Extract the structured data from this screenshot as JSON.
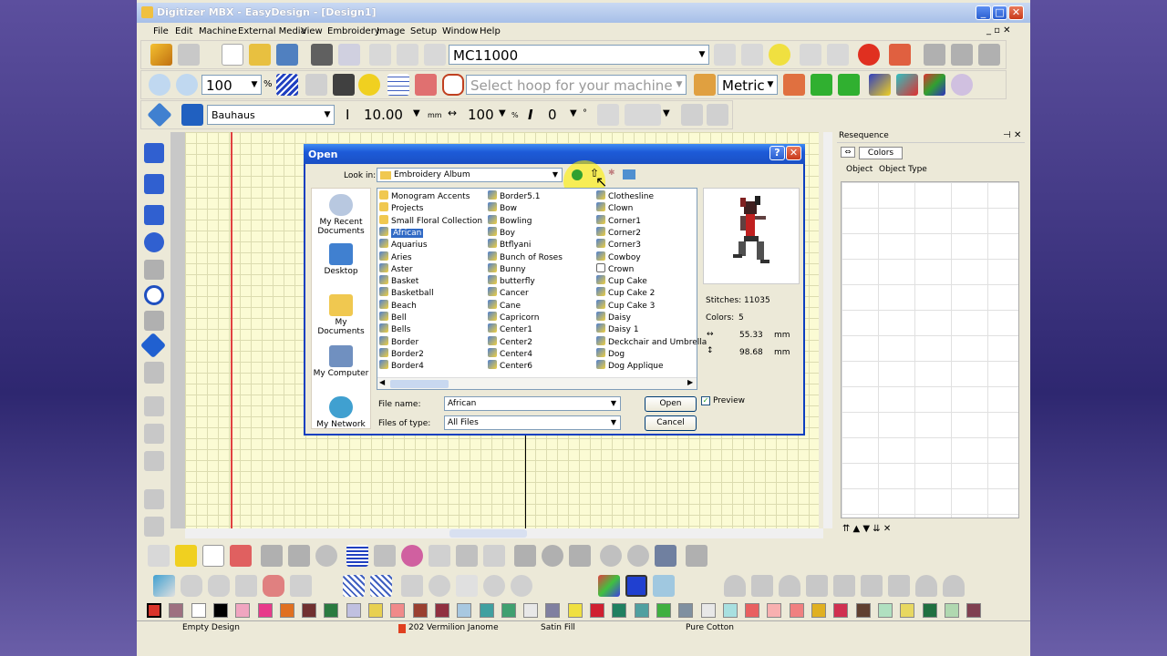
{
  "app": {
    "title": "Digitizer MBX - EasyDesign - [Design1]"
  },
  "menu": [
    "File",
    "Edit",
    "Machine",
    "External Media",
    "View",
    "Embroidery",
    "Image",
    "Setup",
    "Window",
    "Help"
  ],
  "toolbar": {
    "machine": "MC11000",
    "zoom": "100",
    "zoom_unit": "%",
    "hoop_placeholder": "Select hoop for your machine...",
    "units": "Metric"
  },
  "font_toolbar": {
    "font": "Bauhaus",
    "size": "10.00",
    "size_unit": "mm",
    "width": "100",
    "width_unit": "%",
    "angle": "0",
    "angle_unit": "°"
  },
  "resequence": {
    "title": "Resequence",
    "colors_label": "Colors",
    "col_object": "Object",
    "col_type": "Object Type"
  },
  "dialog": {
    "title": "Open",
    "look_in_label": "Look in:",
    "look_in_value": "Embroidery Album",
    "places": [
      "My Recent Documents",
      "Desktop",
      "My Documents",
      "My Computer",
      "My Network"
    ],
    "files": {
      "col1": [
        "Monogram Accents",
        "Projects",
        "Small Floral Collection",
        "African",
        "Aquarius",
        "Aries",
        "Aster",
        "Basket",
        "Basketball",
        "Beach",
        "Bell",
        "Bells",
        "Border",
        "Border2",
        "Border4"
      ],
      "col2": [
        "Border5.1",
        "Bow",
        "Bowling",
        "Boy",
        "Btflyani",
        "Bunch of Roses",
        "Bunny",
        "butterfly",
        "Cancer",
        "Cane",
        "Capricorn",
        "Center1",
        "Center2",
        "Center4",
        "Center6"
      ],
      "col3": [
        "Clothesline",
        "Clown",
        "Corner1",
        "Corner2",
        "Corner3",
        "Cowboy",
        "Crown",
        "Cup Cake",
        "Cup Cake 2",
        "Cup Cake 3",
        "Daisy",
        "Daisy 1",
        "Deckchair and Umbrella",
        "Dog",
        "Dog Applique"
      ]
    },
    "selected": "African",
    "info": {
      "stitches": "Stitches: 11035",
      "colors_label": "Colors:",
      "colors": "5",
      "width": "55.33",
      "height": "98.68",
      "unit": "mm"
    },
    "file_name_label": "File name:",
    "file_name": "African",
    "file_type_label": "Files of type:",
    "file_type": "All Files",
    "preview_label": "Preview",
    "open_label": "Open",
    "cancel_label": "Cancel"
  },
  "status": {
    "design": "Empty Design",
    "thread": "202 Vermilion Janome",
    "fill": "Satin Fill",
    "material": "Pure Cotton"
  },
  "palette": [
    "#d9342a",
    "#9e7080",
    "#ffffff",
    "#000000",
    "#f0a5c0",
    "#e83a8a",
    "#e07020",
    "#703030",
    "#2a7a40",
    "#c0c0e0",
    "#e8d050",
    "#f08a8a",
    "#9a4030",
    "#903040",
    "#a8c8e0",
    "#40a0a0",
    "#40a070",
    "#e8e8e8",
    "#8080a0",
    "#f0e040",
    "#d02030",
    "#208060",
    "#50a0a0",
    "#40b040",
    "#8090a0",
    "#e8e8e8",
    "#a8e0e0",
    "#e86060",
    "#f8b0b0",
    "#f08080",
    "#e0b020",
    "#d03050",
    "#604030",
    "#b0e0c0",
    "#e8d860",
    "#207040",
    "#b0d8b0",
    "#804050"
  ]
}
